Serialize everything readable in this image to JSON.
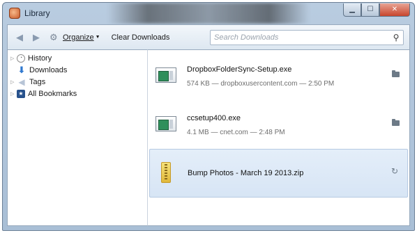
{
  "window": {
    "title": "Library",
    "buttons": {
      "minimize": "▁",
      "maximize": "☐",
      "close": "✕"
    }
  },
  "toolbar": {
    "back_icon": "arrow-left",
    "forward_icon": "arrow-right",
    "organize_label": "Organize",
    "clear_label": "Clear Downloads",
    "search_placeholder": "Search Downloads"
  },
  "sidebar": {
    "items": [
      {
        "label": "History",
        "icon": "history-clock-icon",
        "expandable": true
      },
      {
        "label": "Downloads",
        "icon": "download-arrow-icon",
        "expandable": false
      },
      {
        "label": "Tags",
        "icon": "tag-icon",
        "expandable": true
      },
      {
        "label": "All Bookmarks",
        "icon": "bookmarks-icon",
        "expandable": true
      }
    ]
  },
  "downloads": [
    {
      "filename": "DropboxFolderSync-Setup.exe",
      "meta": "574 KB — dropboxusercontent.com — 2:50 PM",
      "icon": "exe-file-icon",
      "action": "open-folder",
      "selected": false
    },
    {
      "filename": "ccsetup400.exe",
      "meta": "4.1 MB — cnet.com — 2:48 PM",
      "icon": "exe-file-icon",
      "action": "open-folder",
      "selected": false
    },
    {
      "filename": "Bump Photos - March 19 2013.zip",
      "meta": "",
      "icon": "zip-file-icon",
      "action": "retry",
      "selected": true
    }
  ],
  "colors": {
    "window_frame": "#a9bfd6",
    "selection": "#d7e5f5",
    "accent_blue": "#2f78cf"
  }
}
